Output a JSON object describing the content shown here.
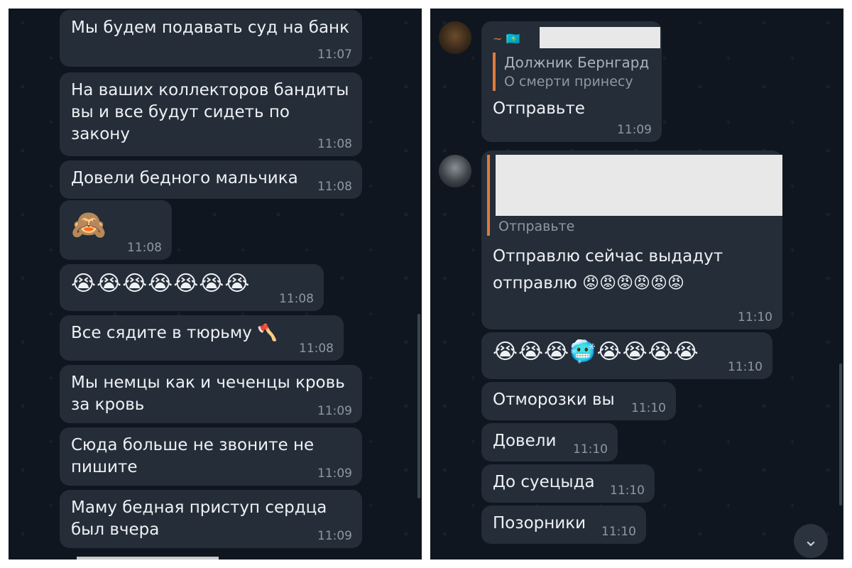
{
  "left": {
    "messages": [
      {
        "text": "Мы будем подавать суд на банк",
        "time": "11:07"
      },
      {
        "text": "На ваших коллекторов бандиты\nвы и все будут сидеть по\nзакону",
        "time": "11:08"
      },
      {
        "text": "Довели бедного мальчика",
        "time": "11:08"
      },
      {
        "text": "🙈",
        "time": "11:08"
      },
      {
        "text": "😭😭😭😭😭😭😭",
        "time": "11:08"
      },
      {
        "text": "Все сядите в тюрьму 🪓",
        "time": "11:08"
      },
      {
        "text": "Мы немцы как и чеченцы кровь\nза кровь",
        "time": "11:09"
      },
      {
        "text": "Сюда больше не звоните не\nпишите",
        "time": "11:09"
      },
      {
        "text": "Маму бедная приступ сердца\nбыл вчера",
        "time": "11:09"
      }
    ]
  },
  "right": {
    "msg1": {
      "sender": "~ 🇰🇿",
      "quote_name": "Должник Бернгард",
      "quote_text": "О смерти принесу",
      "text": "Отправьте",
      "time": "11:09"
    },
    "msg2": {
      "quote_text": "Отправьте",
      "text": "Отправлю сейчас выдадут\nотправлю 😡😡😡😡😡😡",
      "time": "11:10"
    },
    "messages": [
      {
        "text": "😭😭😭🥶😭😭😭😭",
        "time": "11:10"
      },
      {
        "text": "Отморозки вы",
        "time": "11:10"
      },
      {
        "text": "Довели",
        "time": "11:10"
      },
      {
        "text": "До суецыда",
        "time": "11:10"
      },
      {
        "text": "Позорники",
        "time": "11:10"
      }
    ],
    "scroll_icon": "chevron-double-down-icon"
  },
  "colors": {
    "bg": "#10161f",
    "bubble": "#242d38",
    "time": "#8e98a3",
    "quote_bar": "#e17a3a"
  }
}
